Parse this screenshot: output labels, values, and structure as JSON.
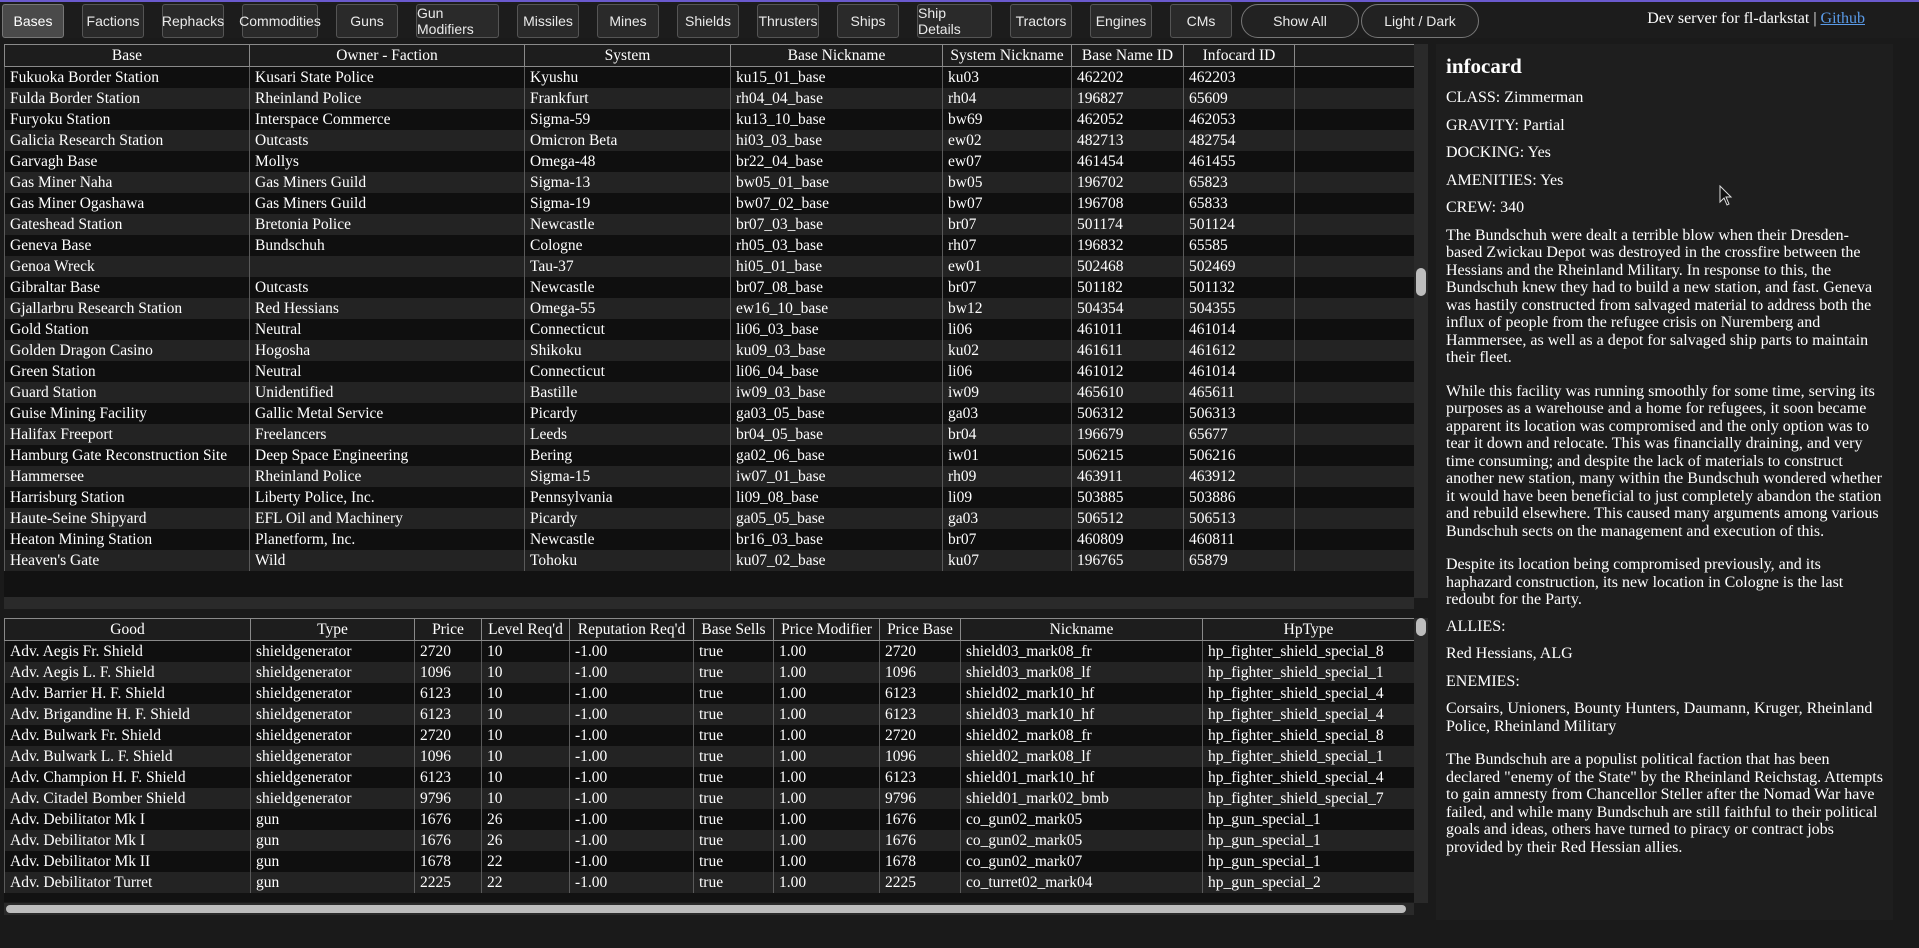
{
  "nav": {
    "tabs": [
      "Bases",
      "Factions",
      "Rephacks",
      "Commodities",
      "Guns",
      "Gun Modifiers",
      "Missiles",
      "Mines",
      "Shields",
      "Thrusters",
      "Ships",
      "Ship Details",
      "Tractors",
      "Engines",
      "CMs"
    ],
    "active_tab": "Bases",
    "show_all": "Show All",
    "light_dark": "Light / Dark",
    "server_text": "Dev server for fl-darkstat |",
    "github_link": "Github"
  },
  "bases_table": {
    "columns": [
      "Base",
      "Owner - Faction",
      "System",
      "Base Nickname",
      "System Nickname",
      "Base Name ID",
      "Infocard ID",
      ""
    ],
    "rows": [
      [
        "Fukuoka Border Station",
        "Kusari State Police",
        "Kyushu",
        "ku15_01_base",
        "ku03",
        "462202",
        "462203",
        ""
      ],
      [
        "Fulda Border Station",
        "Rheinland Police",
        "Frankfurt",
        "rh04_04_base",
        "rh04",
        "196827",
        "65609",
        ""
      ],
      [
        "Furyoku Station",
        "Interspace Commerce",
        "Sigma-59",
        "ku13_10_base",
        "bw69",
        "462052",
        "462053",
        ""
      ],
      [
        "Galicia Research Station",
        "Outcasts",
        "Omicron Beta",
        "hi03_03_base",
        "ew02",
        "482713",
        "482754",
        ""
      ],
      [
        "Garvagh Base",
        "Mollys",
        "Omega-48",
        "br22_04_base",
        "ew07",
        "461454",
        "461455",
        ""
      ],
      [
        "Gas Miner Naha",
        "Gas Miners Guild",
        "Sigma-13",
        "bw05_01_base",
        "bw05",
        "196702",
        "65823",
        ""
      ],
      [
        "Gas Miner Ogashawa",
        "Gas Miners Guild",
        "Sigma-19",
        "bw07_02_base",
        "bw07",
        "196708",
        "65833",
        ""
      ],
      [
        "Gateshead Station",
        "Bretonia Police",
        "Newcastle",
        "br07_03_base",
        "br07",
        "501174",
        "501124",
        ""
      ],
      [
        "Geneva Base",
        "Bundschuh",
        "Cologne",
        "rh05_03_base",
        "rh07",
        "196832",
        "65585",
        ""
      ],
      [
        "Genoa Wreck",
        "",
        "Tau-37",
        "hi05_01_base",
        "ew01",
        "502468",
        "502469",
        ""
      ],
      [
        "Gibraltar Base",
        "Outcasts",
        "Newcastle",
        "br07_08_base",
        "br07",
        "501182",
        "501132",
        ""
      ],
      [
        "Gjallarbru Research Station",
        "Red Hessians",
        "Omega-55",
        "ew16_10_base",
        "bw12",
        "504354",
        "504355",
        ""
      ],
      [
        "Gold Station",
        "Neutral",
        "Connecticut",
        "li06_03_base",
        "li06",
        "461011",
        "461014",
        ""
      ],
      [
        "Golden Dragon Casino",
        "Hogosha",
        "Shikoku",
        "ku09_03_base",
        "ku02",
        "461611",
        "461612",
        ""
      ],
      [
        "Green Station",
        "Neutral",
        "Connecticut",
        "li06_04_base",
        "li06",
        "461012",
        "461014",
        ""
      ],
      [
        "Guard Station",
        "Unidentified",
        "Bastille",
        "iw09_03_base",
        "iw09",
        "465610",
        "465611",
        ""
      ],
      [
        "Guise Mining Facility",
        "Gallic Metal Service",
        "Picardy",
        "ga03_05_base",
        "ga03",
        "506312",
        "506313",
        ""
      ],
      [
        "Halifax Freeport",
        "Freelancers",
        "Leeds",
        "br04_05_base",
        "br04",
        "196679",
        "65677",
        ""
      ],
      [
        "Hamburg Gate Reconstruction Site",
        "Deep Space Engineering",
        "Bering",
        "ga02_06_base",
        "iw01",
        "506215",
        "506216",
        ""
      ],
      [
        "Hammersee",
        "Rheinland Police",
        "Sigma-15",
        "iw07_01_base",
        "rh09",
        "463911",
        "463912",
        ""
      ],
      [
        "Harrisburg Station",
        "Liberty Police, Inc.",
        "Pennsylvania",
        "li09_08_base",
        "li09",
        "503885",
        "503886",
        ""
      ],
      [
        "Haute-Seine Shipyard",
        "EFL Oil and Machinery",
        "Picardy",
        "ga05_05_base",
        "ga03",
        "506512",
        "506513",
        ""
      ],
      [
        "Heaton Mining Station",
        "Planetform, Inc.",
        "Newcastle",
        "br16_03_base",
        "br07",
        "460809",
        "460811",
        ""
      ],
      [
        "Heaven's Gate",
        "Wild",
        "Tohoku",
        "ku07_02_base",
        "ku07",
        "196765",
        "65879",
        ""
      ]
    ]
  },
  "market_table": {
    "columns": [
      "Good",
      "Type",
      "Price",
      "Level Req'd",
      "Reputation Req'd",
      "Base Sells",
      "Price Modifier",
      "Price Base",
      "Nickname",
      "HpType"
    ],
    "rows": [
      [
        "Adv. Aegis Fr. Shield",
        "shieldgenerator",
        "2720",
        "10",
        "-1.00",
        "true",
        "1.00",
        "2720",
        "shield03_mark08_fr",
        "hp_fighter_shield_special_8"
      ],
      [
        "Adv. Aegis L. F. Shield",
        "shieldgenerator",
        "1096",
        "10",
        "-1.00",
        "true",
        "1.00",
        "1096",
        "shield03_mark08_lf",
        "hp_fighter_shield_special_1"
      ],
      [
        "Adv. Barrier H. F. Shield",
        "shieldgenerator",
        "6123",
        "10",
        "-1.00",
        "true",
        "1.00",
        "6123",
        "shield02_mark10_hf",
        "hp_fighter_shield_special_4"
      ],
      [
        "Adv. Brigandine H. F. Shield",
        "shieldgenerator",
        "6123",
        "10",
        "-1.00",
        "true",
        "1.00",
        "6123",
        "shield03_mark10_hf",
        "hp_fighter_shield_special_4"
      ],
      [
        "Adv. Bulwark Fr. Shield",
        "shieldgenerator",
        "2720",
        "10",
        "-1.00",
        "true",
        "1.00",
        "2720",
        "shield02_mark08_fr",
        "hp_fighter_shield_special_8"
      ],
      [
        "Adv. Bulwark L. F. Shield",
        "shieldgenerator",
        "1096",
        "10",
        "-1.00",
        "true",
        "1.00",
        "1096",
        "shield02_mark08_lf",
        "hp_fighter_shield_special_1"
      ],
      [
        "Adv. Champion H. F. Shield",
        "shieldgenerator",
        "6123",
        "10",
        "-1.00",
        "true",
        "1.00",
        "6123",
        "shield01_mark10_hf",
        "hp_fighter_shield_special_4"
      ],
      [
        "Adv. Citadel Bomber Shield",
        "shieldgenerator",
        "9796",
        "10",
        "-1.00",
        "true",
        "1.00",
        "9796",
        "shield01_mark02_bmb",
        "hp_fighter_shield_special_7"
      ],
      [
        "Adv. Debilitator Mk I",
        "gun",
        "1676",
        "26",
        "-1.00",
        "true",
        "1.00",
        "1676",
        "co_gun02_mark05",
        "hp_gun_special_1"
      ],
      [
        "Adv. Debilitator Mk I",
        "gun",
        "1676",
        "26",
        "-1.00",
        "true",
        "1.00",
        "1676",
        "co_gun02_mark05",
        "hp_gun_special_1"
      ],
      [
        "Adv. Debilitator Mk II",
        "gun",
        "1678",
        "22",
        "-1.00",
        "true",
        "1.00",
        "1678",
        "co_gun02_mark07",
        "hp_gun_special_1"
      ],
      [
        "Adv. Debilitator Turret",
        "gun",
        "2225",
        "22",
        "-1.00",
        "true",
        "1.00",
        "2225",
        "co_turret02_mark04",
        "hp_gun_special_2"
      ]
    ]
  },
  "infocard": {
    "title": "infocard",
    "fields": [
      "CLASS: Zimmerman",
      "GRAVITY: Partial",
      "DOCKING: Yes",
      "AMENITIES: Yes",
      "CREW: 340"
    ],
    "paragraphs": [
      "The Bundschuh were dealt a terrible blow when their Dresden-based Zwickau Depot was destroyed in the crossfire between the Hessians and the Rheinland Military. In response to this, the Bundschuh knew they had to build a new station, and fast. Geneva was hastily constructed from salvaged material to address both the influx of people from the refugee crisis on Nuremberg and Hammersee, as well as a depot for salvaged ship parts to maintain their fleet.",
      "While this facility was running smoothly for some time, serving its purposes as a warehouse and a home for refugees, it soon became apparent its location was compromised and the only option was to tear it down and relocate. This was financially draining, and very time consuming; and despite the lack of materials to construct another new station, many within the Bundschuh wondered whether it would have been beneficial to just completely abandon the station and rebuild elsewhere. This caused many arguments among various Bundschuh sects on the management and execution of this.",
      "Despite its location being compromised previously, and its haphazard construction, its new location in Cologne is the last redoubt for the Party."
    ],
    "allies_label": "ALLIES:",
    "allies": "Red Hessians, ALG",
    "enemies_label": "ENEMIES:",
    "enemies": "Corsairs, Unioners, Bounty Hunters, Daumann, Kruger, Rheinland Police, Rheinland Military",
    "faction_description": "The Bundschuh are a populist political faction that has been declared \"enemy of the State\" by the Rheinland Reichstag. Attempts to gain amnesty from Chancellor Steller after the Nomad War have failed, and while many Bundschuh are still faithful to their political goals and ideas, others have turned to piracy or contract jobs provided by their Red Hessian allies."
  }
}
